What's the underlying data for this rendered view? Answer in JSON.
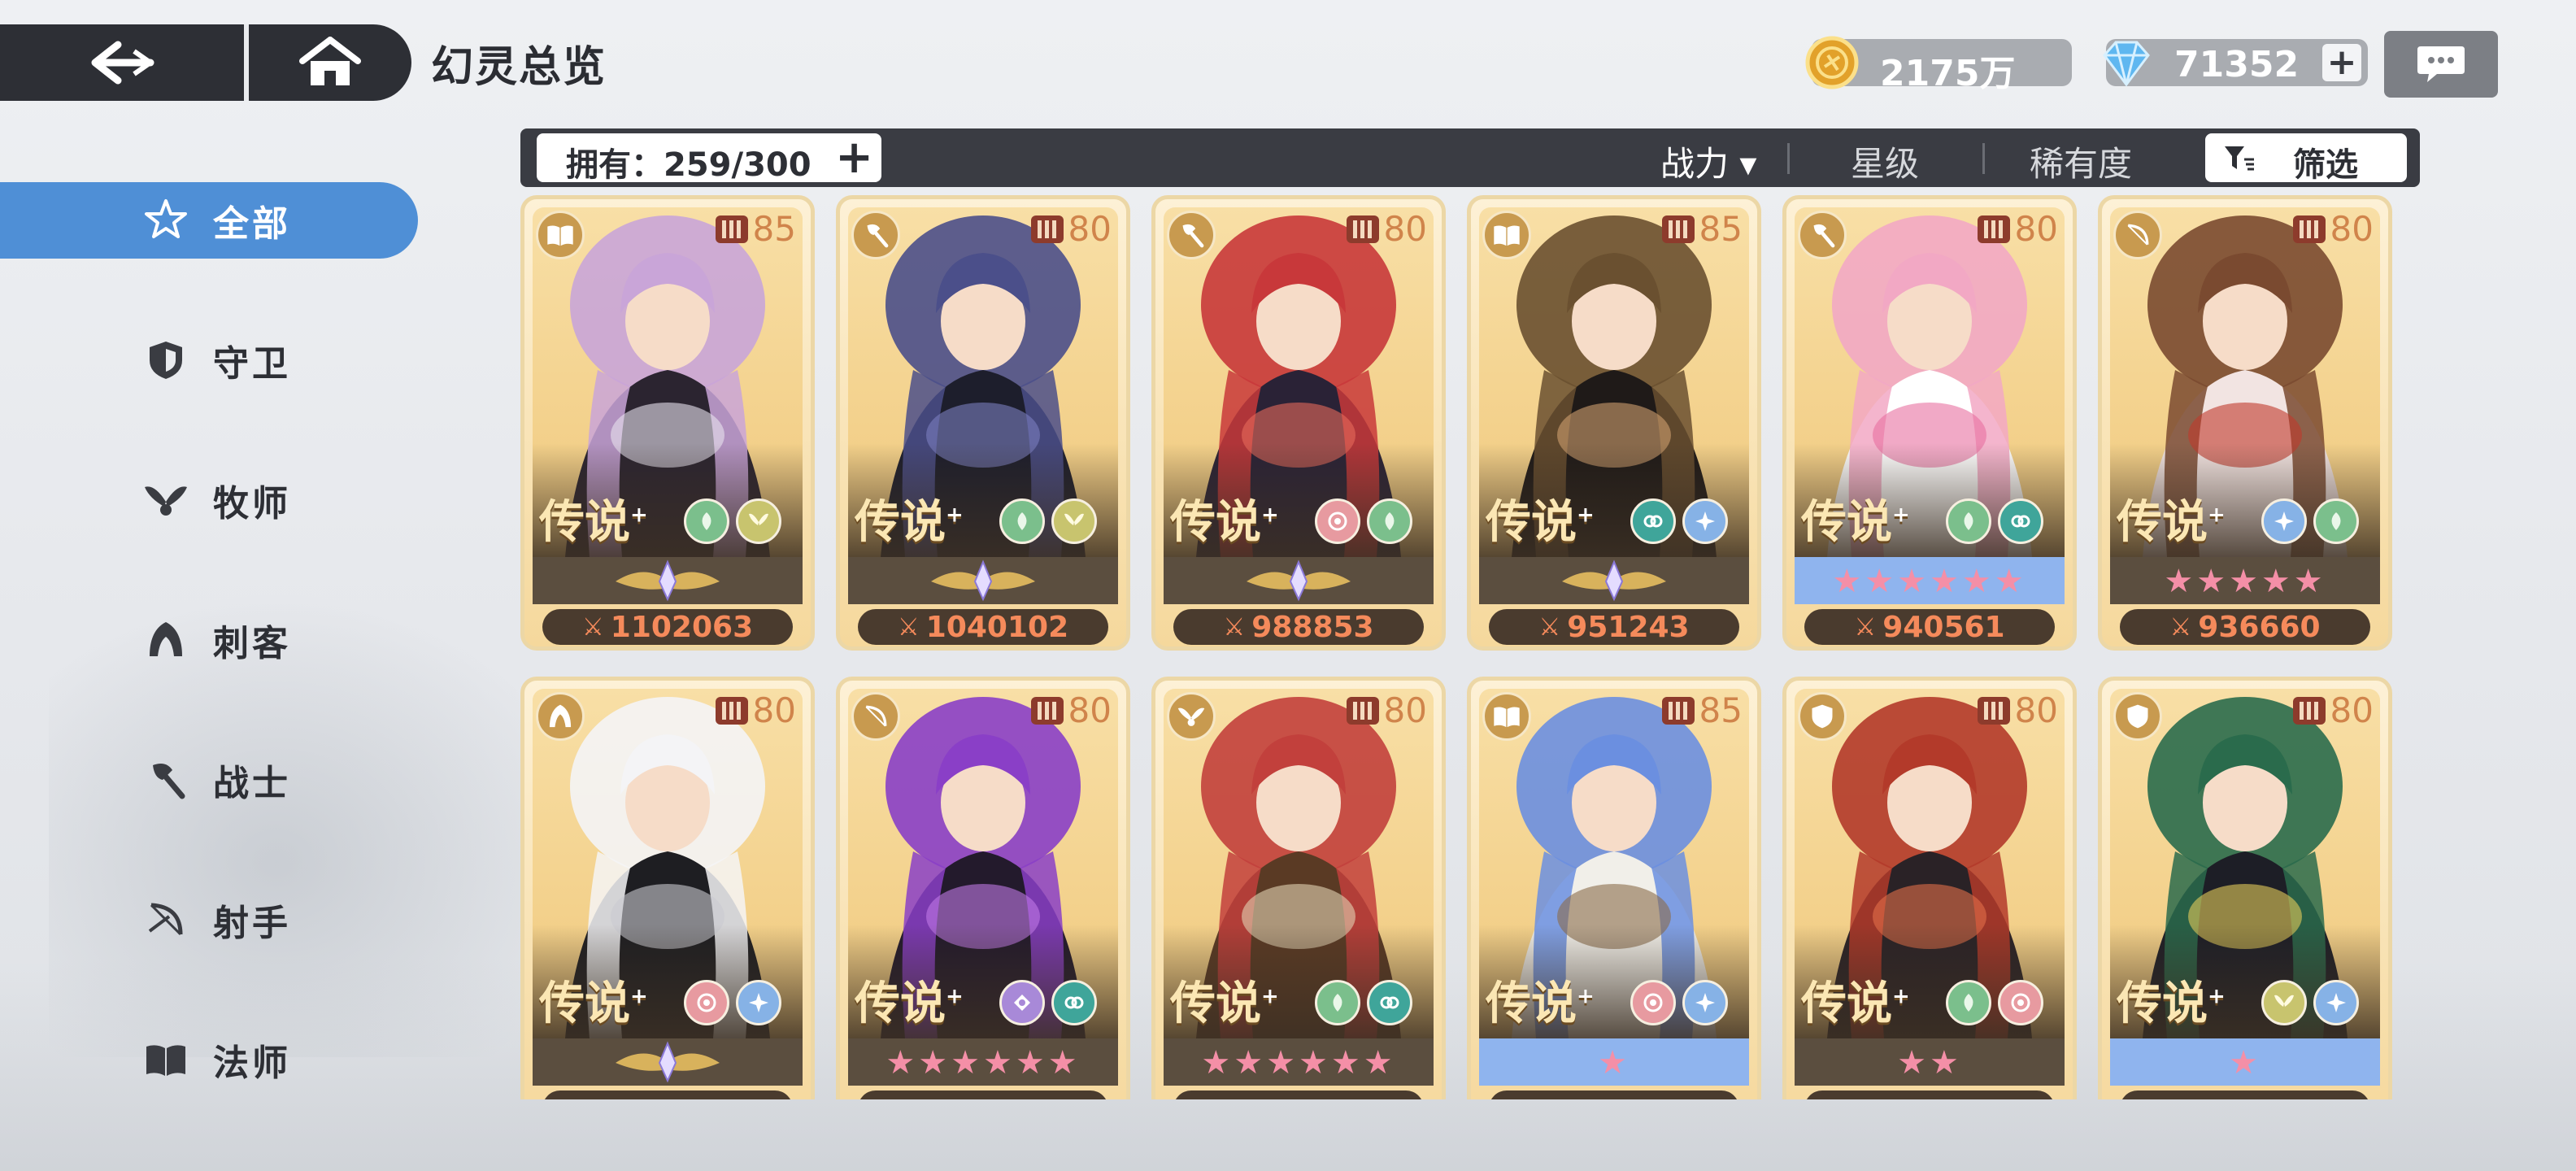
{
  "header": {
    "title": "幻灵总览",
    "gold": "2175万",
    "gems": "71352",
    "plus": "+"
  },
  "sidebar": {
    "items": [
      {
        "label": "全部",
        "icon": "star-icon",
        "active": true
      },
      {
        "label": "守卫",
        "icon": "shield-icon"
      },
      {
        "label": "牧师",
        "icon": "wings-icon"
      },
      {
        "label": "刺客",
        "icon": "hood-icon"
      },
      {
        "label": "战士",
        "icon": "axe-icon"
      },
      {
        "label": "射手",
        "icon": "bow-icon"
      },
      {
        "label": "法师",
        "icon": "book-icon"
      }
    ]
  },
  "filter_bar": {
    "owned": "拥有：259/300",
    "plus": "+",
    "sort_power": "战力 ▾",
    "sort_star": "星级",
    "sort_rarity": "稀有度",
    "filter": "筛选"
  },
  "cards": [
    {
      "class_icon": "book-icon",
      "level": "85",
      "rarity": "传说",
      "elements": [
        "leaf",
        "wing"
      ],
      "stars": "emblem",
      "power": "1102063",
      "palette": [
        "#c9a5d8",
        "#2b2430",
        "#e8e2ee"
      ]
    },
    {
      "class_icon": "axe-icon",
      "level": "80",
      "rarity": "传说",
      "elements": [
        "leaf",
        "wing"
      ],
      "stars": "emblem",
      "power": "1040102",
      "palette": [
        "#4b4f8a",
        "#1d1e2c",
        "#7b7ec0"
      ]
    },
    {
      "class_icon": "axe-icon",
      "level": "80",
      "rarity": "传说",
      "elements": [
        "swirl",
        "leaf"
      ],
      "stars": "emblem",
      "power": "988853",
      "palette": [
        "#c8383a",
        "#2a2236",
        "#e86a5b"
      ]
    },
    {
      "class_icon": "book-icon",
      "level": "85",
      "rarity": "传说",
      "elements": [
        "ring",
        "ice"
      ],
      "stars": "emblem",
      "power": "951243",
      "palette": [
        "#6a5030",
        "#1f1a18",
        "#d1a070"
      ]
    },
    {
      "class_icon": "axe-icon",
      "level": "80",
      "rarity": "传说",
      "elements": [
        "leaf",
        "ring"
      ],
      "stars": "★★★★★★",
      "band": "blue",
      "power": "940561",
      "palette": [
        "#f2a8c4",
        "#ffffff",
        "#e76fa0"
      ]
    },
    {
      "class_icon": "bow-icon",
      "level": "80",
      "rarity": "传说",
      "elements": [
        "ice",
        "leaf"
      ],
      "stars": "★★★★★",
      "power": "936660",
      "palette": [
        "#7a4a30",
        "#f2e4e2",
        "#c0392b"
      ]
    },
    {
      "class_icon": "hood-icon",
      "level": "80",
      "rarity": "传说",
      "elements": [
        "swirl",
        "ice"
      ],
      "stars": "emblem",
      "power": "",
      "palette": [
        "#f4f4f6",
        "#1e1e22",
        "#c9c9d0"
      ]
    },
    {
      "class_icon": "bow-icon",
      "level": "80",
      "rarity": "传说",
      "elements": [
        "eye",
        "ring"
      ],
      "stars": "★★★★★★",
      "power": "",
      "palette": [
        "#8a3fc7",
        "#231a2c",
        "#c07ae6"
      ]
    },
    {
      "class_icon": "wings-icon",
      "level": "80",
      "rarity": "传说",
      "elements": [
        "leaf",
        "ring"
      ],
      "stars": "★★★★★★",
      "power": "",
      "palette": [
        "#c2403c",
        "#5a3a24",
        "#e3d3b4"
      ]
    },
    {
      "class_icon": "book-icon",
      "level": "85",
      "rarity": "传说",
      "elements": [
        "swirl",
        "ice"
      ],
      "stars": "★",
      "band": "blue",
      "power": "",
      "palette": [
        "#6b8fe0",
        "#f1efe9",
        "#8a6a4a"
      ]
    },
    {
      "class_icon": "shield-icon",
      "level": "80",
      "rarity": "传说",
      "elements": [
        "leaf",
        "swirl"
      ],
      "stars": "★★",
      "power": "",
      "palette": [
        "#b33a2a",
        "#2a2226",
        "#e36f4a"
      ]
    },
    {
      "class_icon": "shield-icon",
      "level": "80",
      "rarity": "传说",
      "elements": [
        "wing",
        "ice"
      ],
      "stars": "★",
      "band": "blue",
      "power": "",
      "palette": [
        "#2a6b4c",
        "#1d1e26",
        "#e4cc5a"
      ]
    }
  ]
}
